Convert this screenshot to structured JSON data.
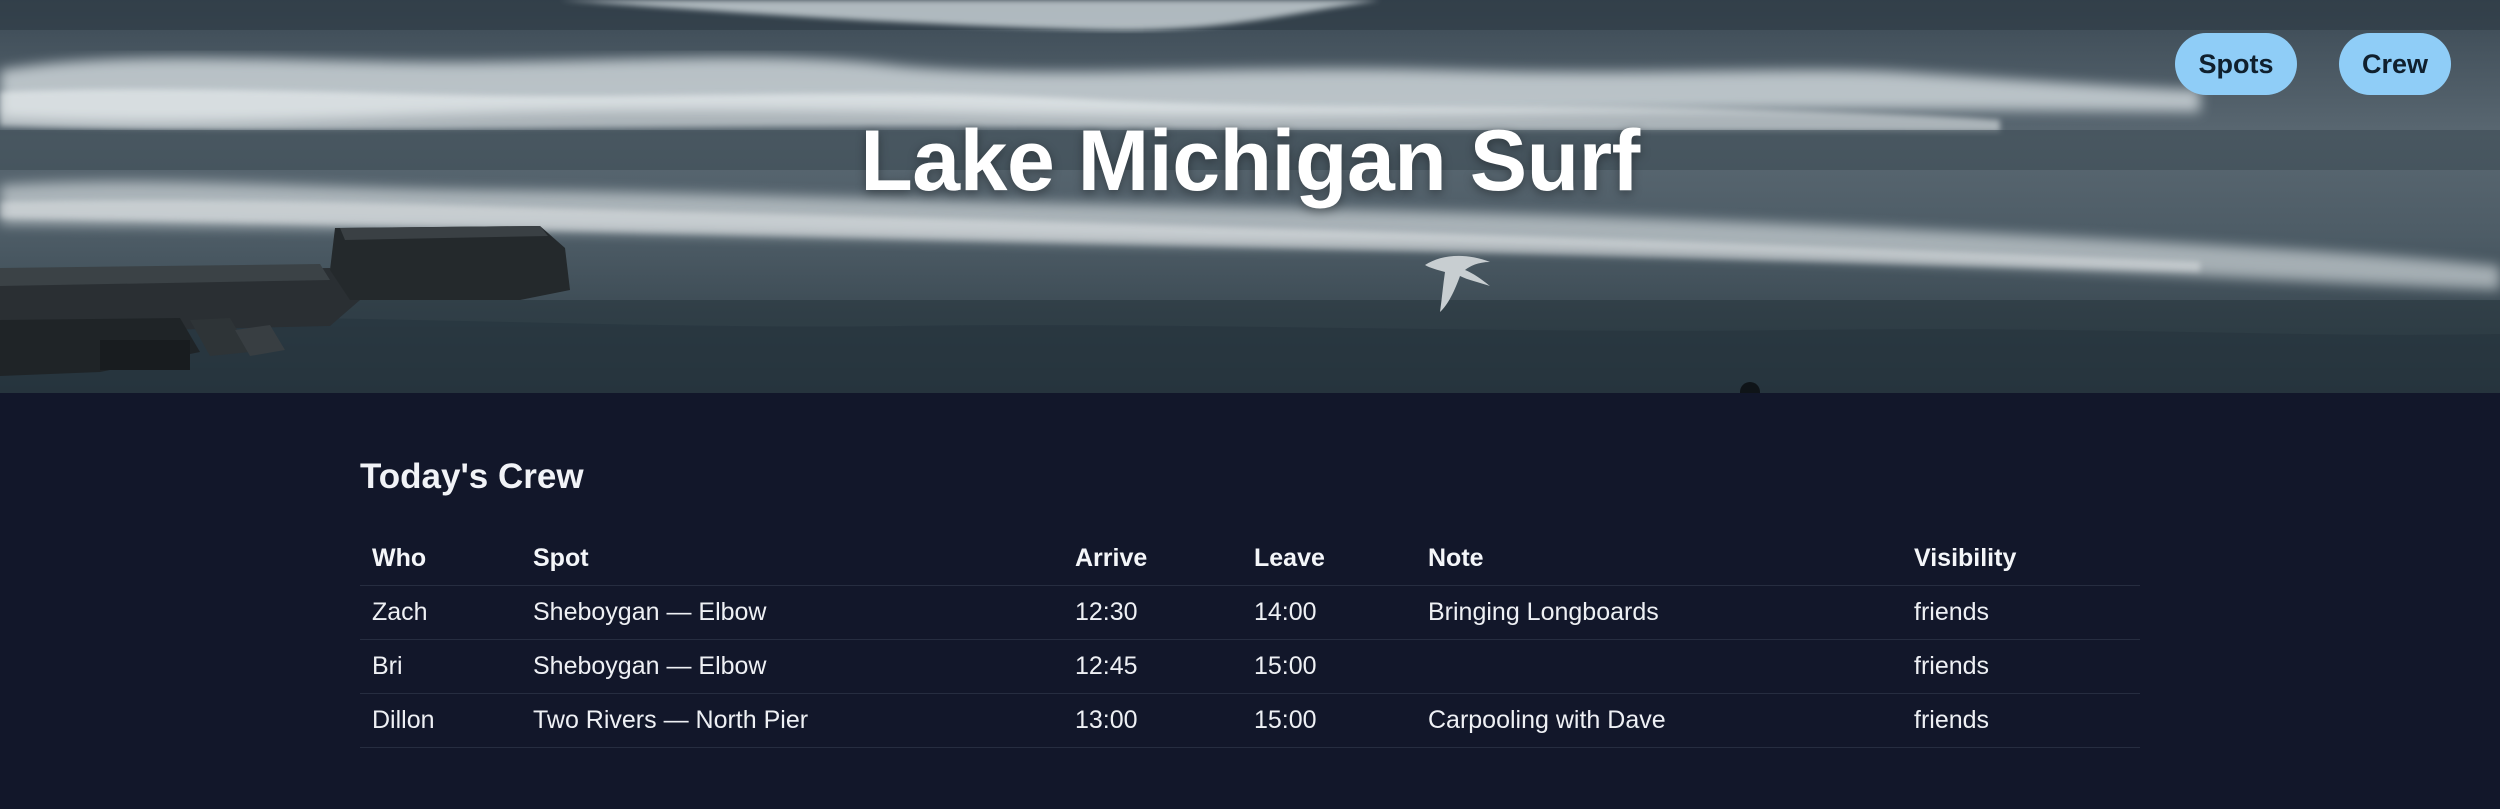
{
  "hero": {
    "title": "Lake Michigan Surf"
  },
  "nav": {
    "spots_label": "Spots",
    "crew_label": "Crew"
  },
  "crew_section": {
    "title": "Today's Crew",
    "columns": [
      "Who",
      "Spot",
      "Arrive",
      "Leave",
      "Note",
      "Visibility"
    ],
    "rows": [
      {
        "who": "Zach",
        "spot": "Sheboygan — Elbow",
        "arrive": "12:30",
        "leave": "14:00",
        "note": "Bringing Longboards",
        "visibility": "friends"
      },
      {
        "who": "Bri",
        "spot": "Sheboygan — Elbow",
        "arrive": "12:45",
        "leave": "15:00",
        "note": "",
        "visibility": "friends"
      },
      {
        "who": "Dillon",
        "spot": "Two Rivers — North Pier",
        "arrive": "13:00",
        "leave": "15:00",
        "note": "Carpooling with Dave",
        "visibility": "friends"
      }
    ]
  },
  "colors": {
    "page_background": "#12172a",
    "nav_pill": "#8fcdf7",
    "text": "#f1f3f7"
  }
}
